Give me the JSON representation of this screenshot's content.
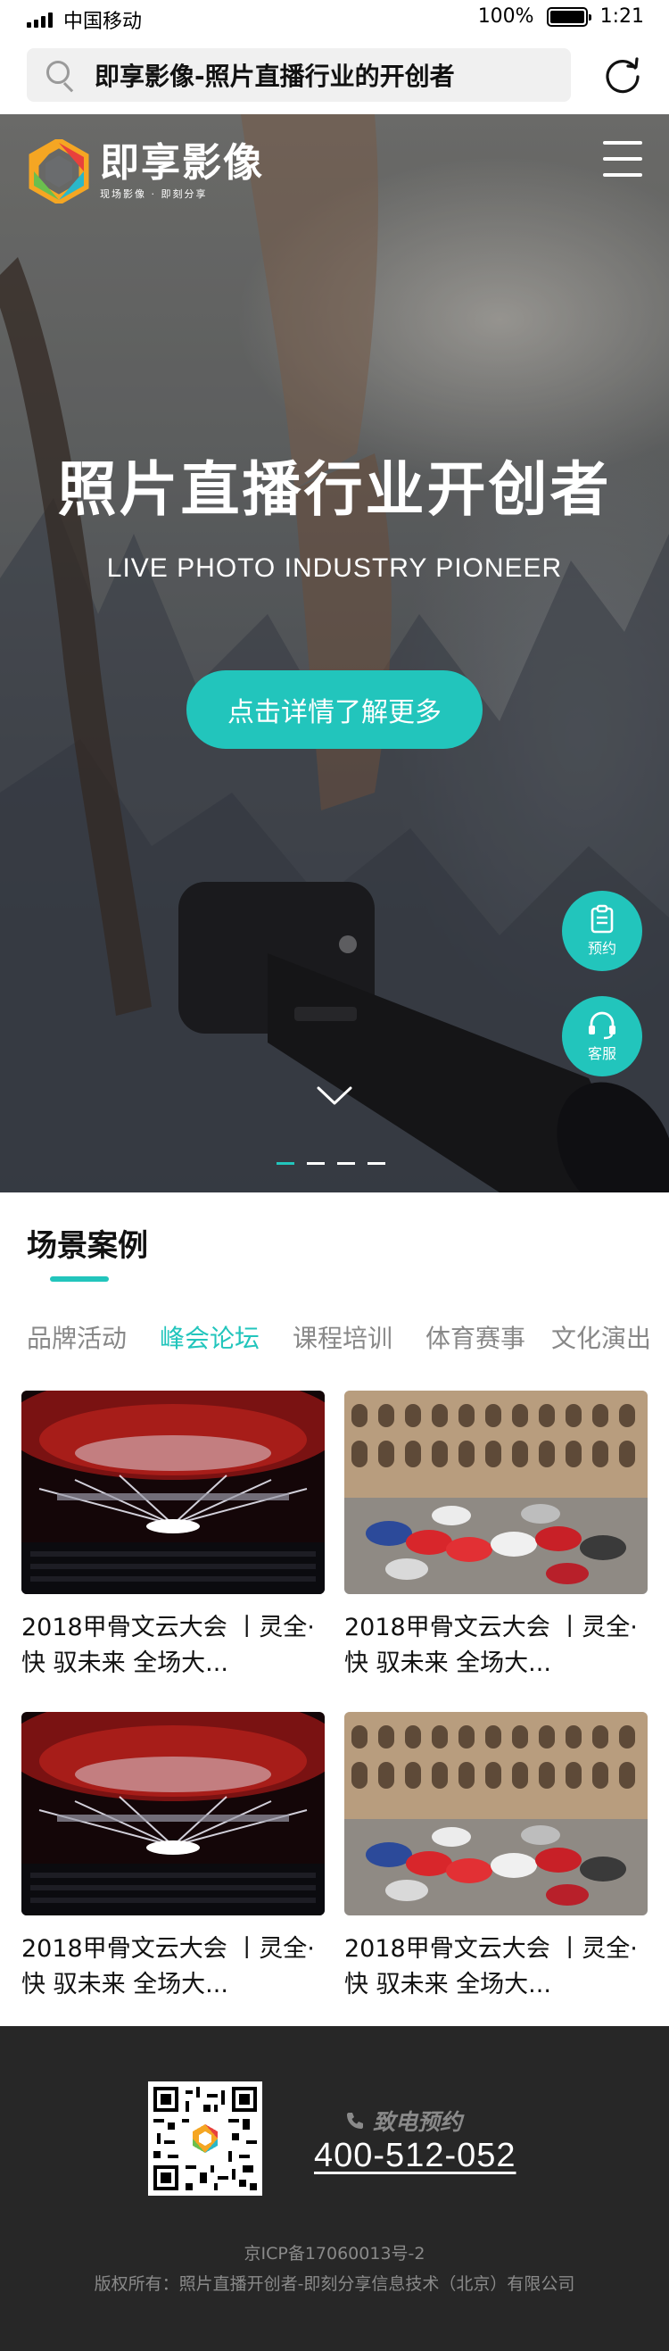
{
  "status_bar": {
    "carrier": "中国移动",
    "battery_text": "100%",
    "battery_level": 1.0,
    "time": "1:21"
  },
  "browser": {
    "address_text": "即享影像-照片直播行业的开创者",
    "icons": [
      "search-icon",
      "reload-icon"
    ]
  },
  "header": {
    "logo_name": "即享影像",
    "logo_tagline": "现场影像 · 即刻分享",
    "icons": [
      "logo-hex-icon",
      "menu-icon"
    ]
  },
  "hero": {
    "title": "照片直播行业开创者",
    "subtitle": "LIVE PHOTO INDUSTRY PIONEER",
    "cta_label": "点击详情了解更多",
    "carousel_count": 4,
    "carousel_active": 1,
    "icons": [
      "chevron-down-icon"
    ]
  },
  "float_buttons": [
    {
      "label": "预约",
      "icon": "clipboard-icon"
    },
    {
      "label": "客服",
      "icon": "headset-icon"
    }
  ],
  "section": {
    "title": "场景案例",
    "tabs": [
      "品牌活动",
      "峰会论坛",
      "课程培训",
      "体育赛事",
      "文化演出"
    ],
    "active_tab": 1,
    "cards": [
      {
        "title": "2018甲骨文云大会 丨灵全·快 驭未来 全场大...",
        "image": "conference-hall"
      },
      {
        "title": "2018甲骨文云大会 丨灵全·快 驭未来 全场大...",
        "image": "colosseum-cars"
      },
      {
        "title": "2018甲骨文云大会 丨灵全·快 驭未来 全场大...",
        "image": "conference-hall"
      },
      {
        "title": "2018甲骨文云大会 丨灵全·快 驭未来 全场大...",
        "image": "colosseum-cars"
      }
    ]
  },
  "footer": {
    "phone_label": "致电预约",
    "phone_number": "400-512-052",
    "icp": "京ICP备17060013号-2",
    "copyright": "版权所有：照片直播开创者-即刻分享信息技术（北京）有限公司",
    "icons": [
      "qr-code-icon",
      "phone-icon"
    ]
  },
  "colors": {
    "accent": "#22c5bc",
    "footer_bg": "#272727",
    "text_dark": "#111111",
    "tab_inactive": "#888888"
  }
}
